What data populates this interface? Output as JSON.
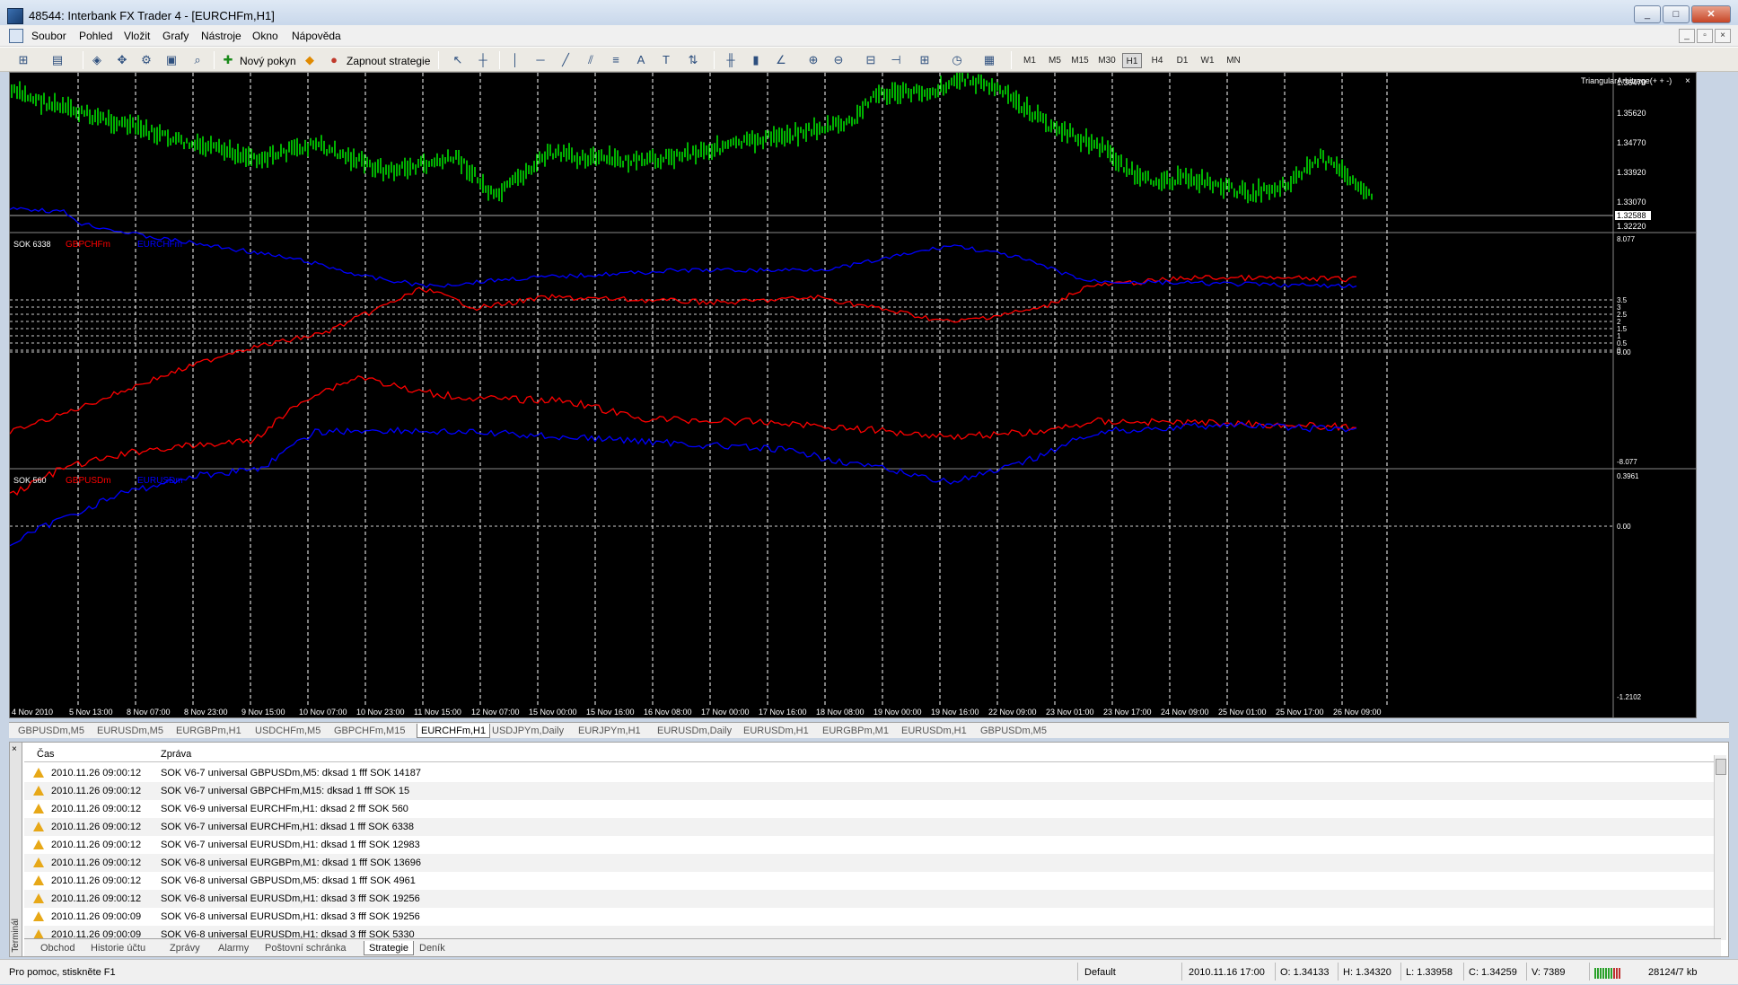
{
  "window": {
    "title": "48544: Interbank FX Trader 4 - [EURCHFm,H1]",
    "buttons": [
      "_",
      "□",
      "✕"
    ]
  },
  "menu": [
    "Soubor",
    "Pohled",
    "Vložit",
    "Grafy",
    "Nástroje",
    "Okno",
    "Nápověda"
  ],
  "toolbar": {
    "new_order_label": "Nový pokyn",
    "strategy_label": "Zapnout strategie",
    "timeframes": [
      "M1",
      "M5",
      "M15",
      "M30",
      "H1",
      "H4",
      "D1",
      "W1",
      "MN"
    ],
    "active_timeframe": "H1"
  },
  "chart": {
    "indicator_label": "TriangularArbitrage(+ + -)",
    "price_ticks": [
      "1.36470",
      "1.35620",
      "1.34770",
      "1.33920",
      "1.33070",
      "1.32588",
      "1.32220"
    ],
    "pane2_label": "SOK 6338",
    "pane2_series": [
      "GBPCHFm",
      "EURCHFm"
    ],
    "pane2_ticks": [
      "8.077",
      "3.5",
      "3",
      "2.5",
      "2",
      "1.5",
      "1",
      "0.5",
      "0",
      "0.00",
      "-8.077"
    ],
    "pane3_label": "SOK 560",
    "pane3_series": [
      "GBPUSDm",
      "EURUSDm"
    ],
    "pane3_ticks": [
      "0.3961",
      "0.00",
      "-1.2102"
    ],
    "time_ticks": [
      "4 Nov 2010",
      "5 Nov 13:00",
      "8 Nov 07:00",
      "8 Nov 23:00",
      "9 Nov 15:00",
      "10 Nov 07:00",
      "10 Nov 23:00",
      "11 Nov 15:00",
      "12 Nov 07:00",
      "15 Nov 00:00",
      "15 Nov 16:00",
      "16 Nov 08:00",
      "17 Nov 00:00",
      "17 Nov 16:00",
      "18 Nov 08:00",
      "19 Nov 00:00",
      "19 Nov 16:00",
      "22 Nov 09:00",
      "23 Nov 01:00",
      "23 Nov 17:00",
      "24 Nov 09:00",
      "25 Nov 01:00",
      "25 Nov 17:00",
      "26 Nov 09:00"
    ],
    "colors": {
      "candles": "#00ff00",
      "red": "#ff0000",
      "blue": "#0000ff",
      "grid": "#ffffff"
    }
  },
  "chart_tabs": [
    "GBPUSDm,M5",
    "EURUSDm,M5",
    "EURGBPm,H1",
    "USDCHFm,M5",
    "GBPCHFm,M15",
    "EURCHFm,H1",
    "USDJPYm,Daily",
    "EURJPYm,H1",
    "EURUSDm,Daily",
    "EURUSDm,H1",
    "EURGBPm,M1",
    "EURUSDm,H1",
    "GBPUSDm,M5"
  ],
  "active_chart_tab": "EURCHFm,H1",
  "terminal": {
    "side_label": "Terminál",
    "columns": [
      "Čas",
      "Zpráva"
    ],
    "rows": [
      {
        "time": "2010.11.26 09:00:12",
        "msg": "SOK V6-7 universal GBPUSDm,M5: dksad 1 fff SOK 14187"
      },
      {
        "time": "2010.11.26 09:00:12",
        "msg": "SOK V6-7 universal GBPCHFm,M15: dksad 1 fff SOK 15"
      },
      {
        "time": "2010.11.26 09:00:12",
        "msg": "SOK V6-9 universal EURCHFm,H1: dksad 2 fff SOK 560"
      },
      {
        "time": "2010.11.26 09:00:12",
        "msg": "SOK V6-7 universal EURCHFm,H1: dksad 1 fff SOK 6338"
      },
      {
        "time": "2010.11.26 09:00:12",
        "msg": "SOK V6-7 universal EURUSDm,H1: dksad 1 fff SOK 12983"
      },
      {
        "time": "2010.11.26 09:00:12",
        "msg": "SOK V6-8 universal EURGBPm,M1: dksad 1 fff SOK 13696"
      },
      {
        "time": "2010.11.26 09:00:12",
        "msg": "SOK V6-8 universal GBPUSDm,M5: dksad 1 fff SOK 4961"
      },
      {
        "time": "2010.11.26 09:00:12",
        "msg": "SOK V6-8 universal EURUSDm,H1: dksad 3 fff SOK 19256"
      },
      {
        "time": "2010.11.26 09:00:09",
        "msg": "SOK V6-8 universal EURUSDm,H1: dksad 3 fff SOK 19256"
      },
      {
        "time": "2010.11.26 09:00:09",
        "msg": "SOK V6-8 universal EURUSDm,H1: dksad 3 fff SOK 5330"
      }
    ],
    "tabs": [
      "Obchod",
      "Historie účtu",
      "Zprávy",
      "Alarmy",
      "Poštovní schránka",
      "Strategie",
      "Deník"
    ],
    "active_tab": "Strategie"
  },
  "status": {
    "help": "Pro pomoc, stiskněte F1",
    "profile": "Default",
    "datetime": "2010.11.16 17:00",
    "open": "O: 1.34133",
    "high": "H: 1.34320",
    "low": "L: 1.33958",
    "close": "C: 1.34259",
    "volume": "V: 7389",
    "traffic": "28124/7 kb"
  }
}
